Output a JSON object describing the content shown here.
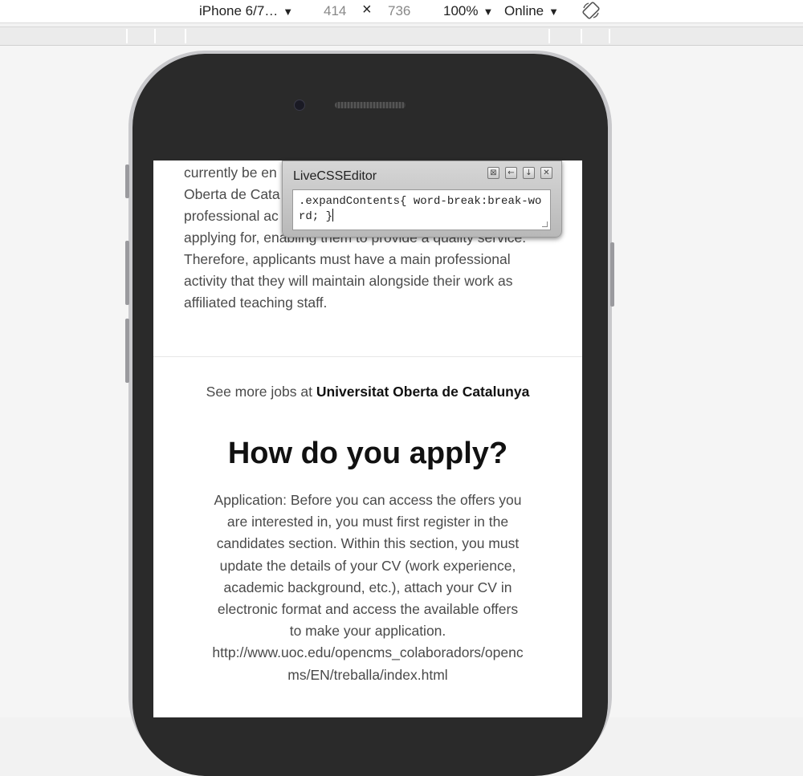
{
  "toolbar": {
    "device_label": "iPhone 6/7…",
    "width_value": "414",
    "dimension_separator": "×",
    "height_value": "736",
    "zoom_label": "100%",
    "network_label": "Online",
    "rotate_icon": "rotate-icon"
  },
  "css_editor": {
    "title": "LiveCSSEditor",
    "code": ".expandContents{ word-break:break-word; }",
    "buttons": [
      "close-icon",
      "arrow-left-icon",
      "arrow-down-icon",
      "dismiss-icon"
    ]
  },
  "page": {
    "job_description": [
      "currently be en",
      "Oberta de Cata",
      "professional ac",
      "applying for, enabling them to provide a quality service.",
      "Therefore, applicants must have a main professional",
      "activity that they will maintain alongside their work as",
      "affiliated teaching staff."
    ],
    "see_more_prefix": "See more jobs at ",
    "see_more_org": "Universitat Oberta de Catalunya",
    "apply_title": "How do you apply?",
    "apply_text": "Application: Before you can access the offers you are interested in, you must first register in the candidates section. Within this section, you must update the details of your CV (work experience, academic background, etc.), attach your CV in electronic format and access the available offers to make your application. http://www.uoc.edu/opencms_colaboradors/opencms/EN/treballa/index.html"
  }
}
